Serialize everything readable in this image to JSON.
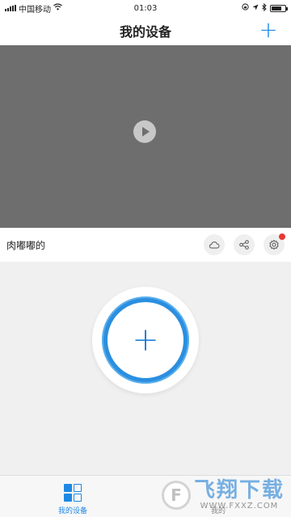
{
  "status_bar": {
    "carrier": "中国移动",
    "time": "01:03",
    "battery_level": 0.75
  },
  "nav": {
    "title": "我的设备",
    "add_symbol": "+"
  },
  "device": {
    "name": "肉嘟嘟的"
  },
  "actions": {
    "icons": [
      "cloud-icon",
      "share-icon",
      "settings-icon"
    ],
    "settings_has_badge": true
  },
  "add_device": {
    "symbol": "+"
  },
  "tabs": [
    {
      "label": "我的设备",
      "active": true
    },
    {
      "label": "我的",
      "active": false
    }
  ],
  "watermark": {
    "logo": "F",
    "main": "飞翔下载",
    "sub": "WWW.FXXZ.COM"
  },
  "colors": {
    "accent": "#1e88e5",
    "video_bg": "#6e6e6e",
    "badge": "#e53935"
  }
}
